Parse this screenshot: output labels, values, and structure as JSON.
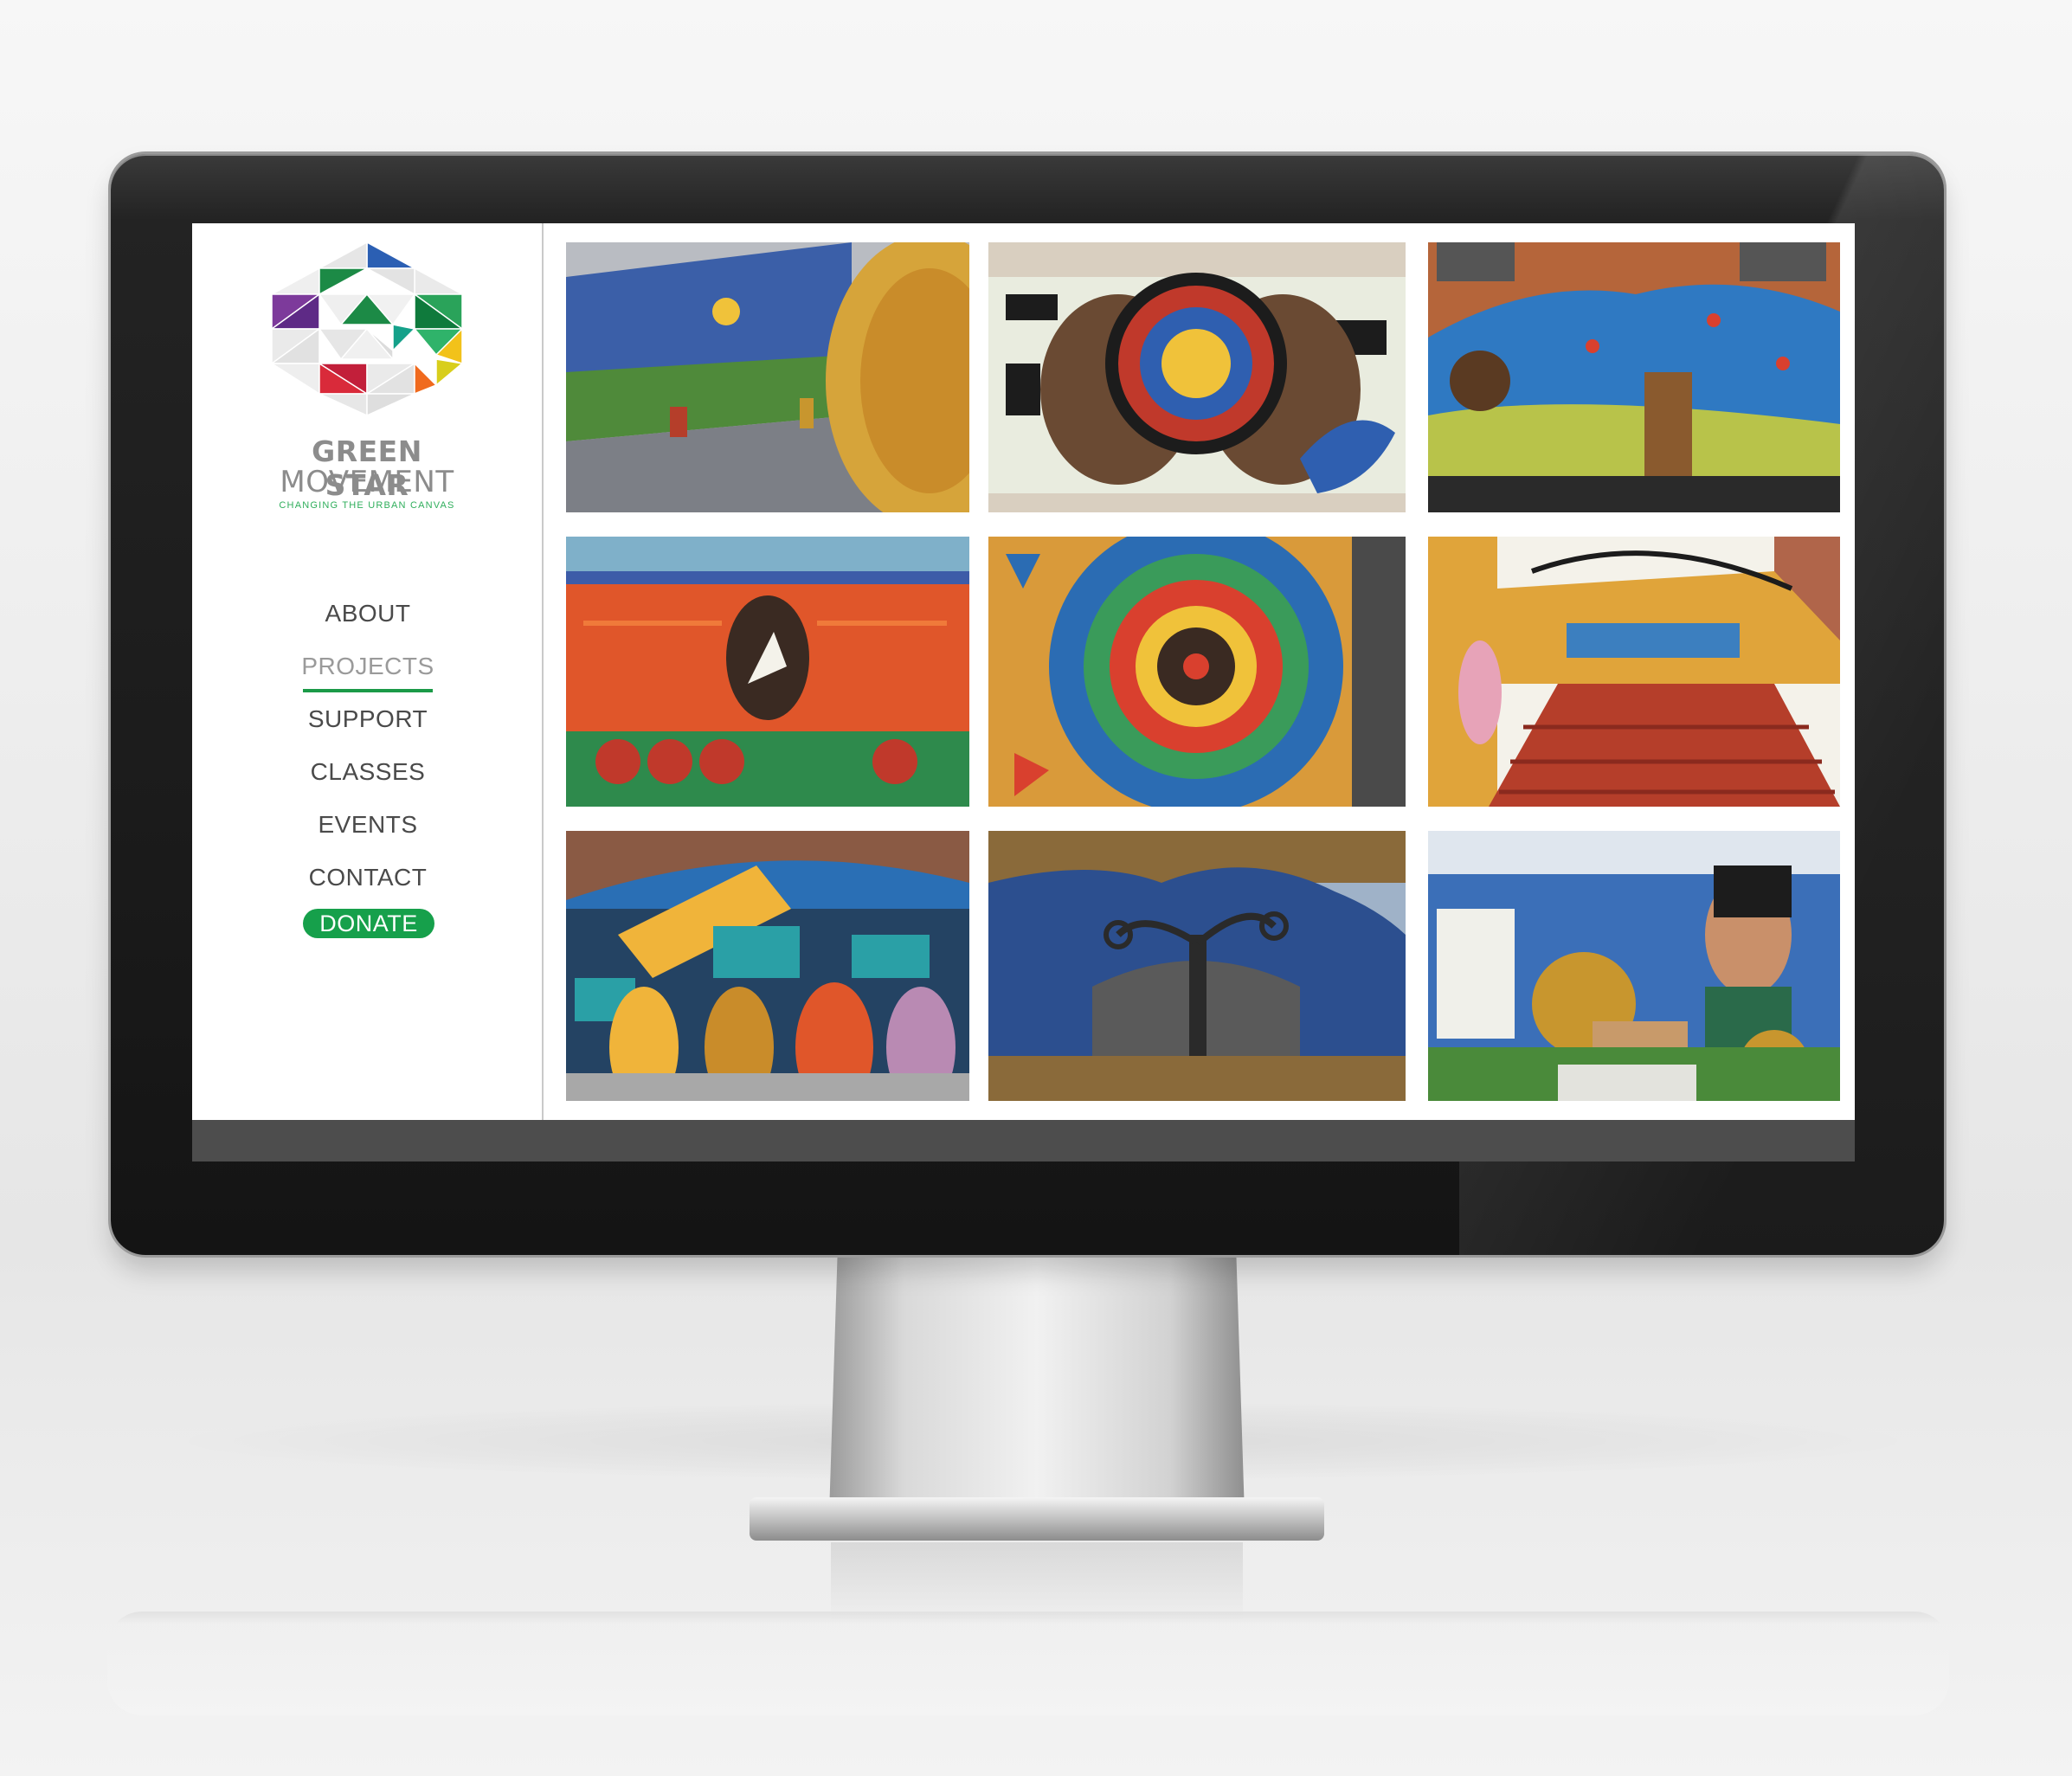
{
  "brand": {
    "name_line1": "GREEN STAR",
    "name_line2": "MOVEMENT",
    "tagline": "CHANGING THE URBAN CANVAS"
  },
  "nav": {
    "items": [
      {
        "label": "ABOUT",
        "active": false
      },
      {
        "label": "PROJECTS",
        "active": true
      },
      {
        "label": "SUPPORT",
        "active": false
      },
      {
        "label": "CLASSES",
        "active": false
      },
      {
        "label": "EVENTS",
        "active": false
      },
      {
        "label": "CONTACT",
        "active": false
      }
    ],
    "donate_label": "DONATE"
  },
  "colors": {
    "accent_green": "#16a04b",
    "nav_text": "#4a4a4a",
    "nav_active_text": "#9a9a9a",
    "logo_gray": "#8c8c8c"
  },
  "gallery": {
    "tiles": [
      {
        "name": "mosaic-alley-wall",
        "palette": [
          "#3b5fa8",
          "#d6a43a",
          "#7c7f86",
          "#4f8a3a"
        ]
      },
      {
        "name": "mosaic-hands-medallion",
        "palette": [
          "#e9ecdf",
          "#1c1c1c",
          "#c0392b",
          "#2f5fb0"
        ]
      },
      {
        "name": "mosaic-tree-of-life-wall",
        "palette": [
          "#2f79c2",
          "#b8c34a",
          "#8a5a2e",
          "#d9402e"
        ]
      },
      {
        "name": "mosaic-hiawatha-poem",
        "palette": [
          "#e0562a",
          "#f07a3a",
          "#2e8a4c",
          "#3d5ca8"
        ]
      },
      {
        "name": "mosaic-mandala",
        "palette": [
          "#2b6cb3",
          "#d9402e",
          "#f0c23a",
          "#3a9b5a"
        ]
      },
      {
        "name": "mosaic-music-staircase",
        "palette": [
          "#b53e2a",
          "#e0a43a",
          "#3c7fbf",
          "#f4f2ea"
        ]
      },
      {
        "name": "mosaic-education-protest",
        "palette": [
          "#1f1f1f",
          "#e0562a",
          "#2aa0a6",
          "#f0b43a"
        ]
      },
      {
        "name": "mosaic-spiral-tree",
        "palette": [
          "#2c4f8f",
          "#5a5a5a",
          "#8a6a3a",
          "#9fb2c8"
        ]
      },
      {
        "name": "mosaic-garden-portrait",
        "palette": [
          "#3b6fb8",
          "#f0f0ea",
          "#c8962e",
          "#4a8a3a"
        ]
      }
    ]
  }
}
